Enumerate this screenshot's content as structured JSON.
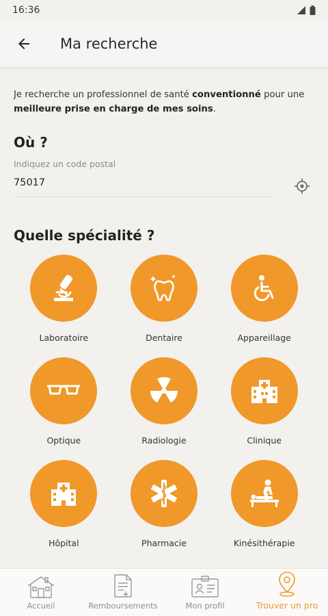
{
  "status": {
    "time": "16:36"
  },
  "appbar": {
    "title": "Ma recherche"
  },
  "intro": {
    "part1": "Je recherche un professionnel de santé ",
    "bold1": "conventionné",
    "part2": " pour une ",
    "bold2": "meilleure prise en charge de mes soins",
    "part3": "."
  },
  "where": {
    "title": "Où ?",
    "label": "Indiquez un code postal",
    "value": "75017"
  },
  "specialty": {
    "title": "Quelle spécialité ?",
    "items": [
      {
        "label": "Laboratoire",
        "icon": "microscope-icon"
      },
      {
        "label": "Dentaire",
        "icon": "tooth-icon"
      },
      {
        "label": "Appareillage",
        "icon": "wheelchair-icon"
      },
      {
        "label": "Optique",
        "icon": "glasses-icon"
      },
      {
        "label": "Radiologie",
        "icon": "radiation-icon"
      },
      {
        "label": "Clinique",
        "icon": "clinic-building-icon"
      },
      {
        "label": "Hôpital",
        "icon": "hospital-icon"
      },
      {
        "label": "Pharmacie",
        "icon": "star-of-life-icon"
      },
      {
        "label": "Kinésithérapie",
        "icon": "massage-icon"
      }
    ]
  },
  "nav": {
    "items": [
      {
        "label": "Accueil",
        "icon": "house-icon"
      },
      {
        "label": "Remboursements",
        "icon": "document-icon"
      },
      {
        "label": "Mon profil",
        "icon": "id-card-icon"
      },
      {
        "label": "Trouver un pro",
        "icon": "map-pin-icon"
      }
    ]
  },
  "colors": {
    "accent": "#f0982a",
    "background": "#f3f1ee"
  }
}
